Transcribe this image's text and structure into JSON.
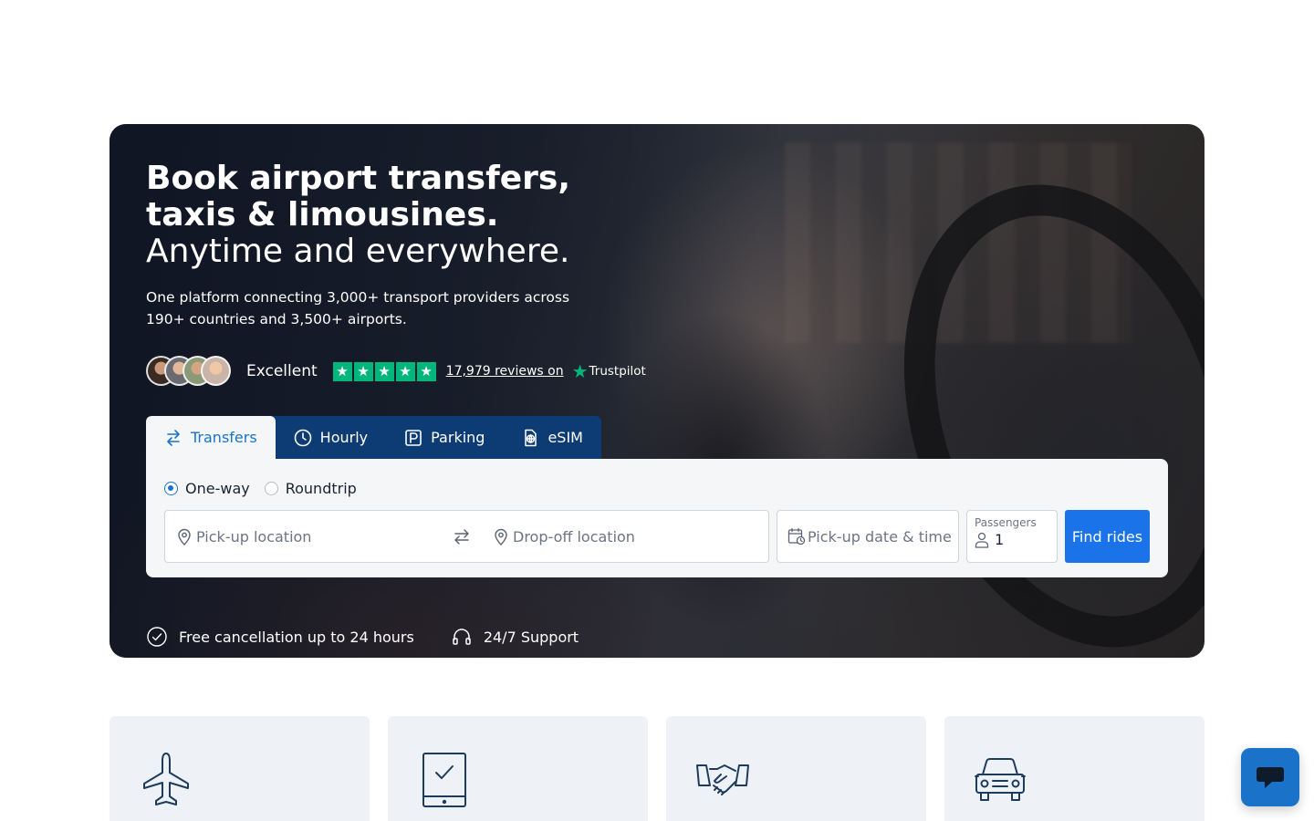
{
  "hero": {
    "title": "Book airport transfers, taxis & limousines.",
    "title_line2": "Anytime and everywhere.",
    "subtitle": "One platform connecting 3,000+ transport providers across 190+ countries and 3,500+ airports.",
    "rating": {
      "label": "Excellent",
      "stars": 5,
      "reviews_text": "17,979 reviews on",
      "brand": "Trustpilot",
      "star_color": "#00b67a"
    }
  },
  "tabs": [
    {
      "label": "Transfers",
      "icon": "transfers-icon",
      "active": true
    },
    {
      "label": "Hourly",
      "icon": "clock-icon",
      "active": false
    },
    {
      "label": "Parking",
      "icon": "parking-icon",
      "active": false
    },
    {
      "label": "eSIM",
      "icon": "esim-icon",
      "active": false
    }
  ],
  "search": {
    "trip_types": [
      {
        "label": "One-way",
        "selected": true
      },
      {
        "label": "Roundtrip",
        "selected": false
      }
    ],
    "pickup_placeholder": "Pick-up location",
    "dropoff_placeholder": "Drop-off location",
    "date_placeholder": "Pick-up date & time",
    "passengers_label": "Passengers",
    "passengers_value": "1",
    "find_button": "Find rides"
  },
  "features": [
    {
      "label": "Free cancellation up to 24 hours",
      "icon": "check-circle-icon"
    },
    {
      "label": "24/7 Support",
      "icon": "headset-icon"
    }
  ],
  "cards": [
    {
      "icon": "airplane-icon"
    },
    {
      "icon": "tablet-check-icon"
    },
    {
      "icon": "handshake-icon"
    },
    {
      "icon": "car-icon"
    }
  ],
  "chat": {
    "icon": "chat-icon"
  },
  "colors": {
    "accent": "#1a73e8",
    "tab_bar": "#0d3b73",
    "panel": "#f4f6f8",
    "card_bg": "#eef2f6",
    "icon_stroke": "#1d3b5c"
  }
}
